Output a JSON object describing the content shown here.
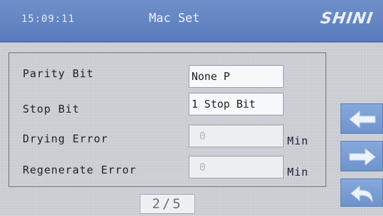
{
  "header": {
    "clock": "15:09:11",
    "title": "Mac Set",
    "logo": "SHINI"
  },
  "settings": [
    {
      "label": "Parity Bit",
      "value": "None P",
      "unit": ""
    },
    {
      "label": "Stop Bit",
      "value": "1 Stop Bit",
      "unit": ""
    },
    {
      "label": "Drying Error",
      "value": "0",
      "unit": "Min"
    },
    {
      "label": "Regenerate Error",
      "value": "0",
      "unit": "Min"
    }
  ],
  "pager": {
    "indicator": "2/5"
  },
  "nav": {
    "prev_icon": "arrow-left-icon",
    "next_icon": "arrow-right-icon",
    "back_icon": "return-arrow-icon"
  },
  "colors": {
    "header": "#6f8fc9",
    "background": "#c9cdd3",
    "nav_button": "#7a9ed3"
  }
}
